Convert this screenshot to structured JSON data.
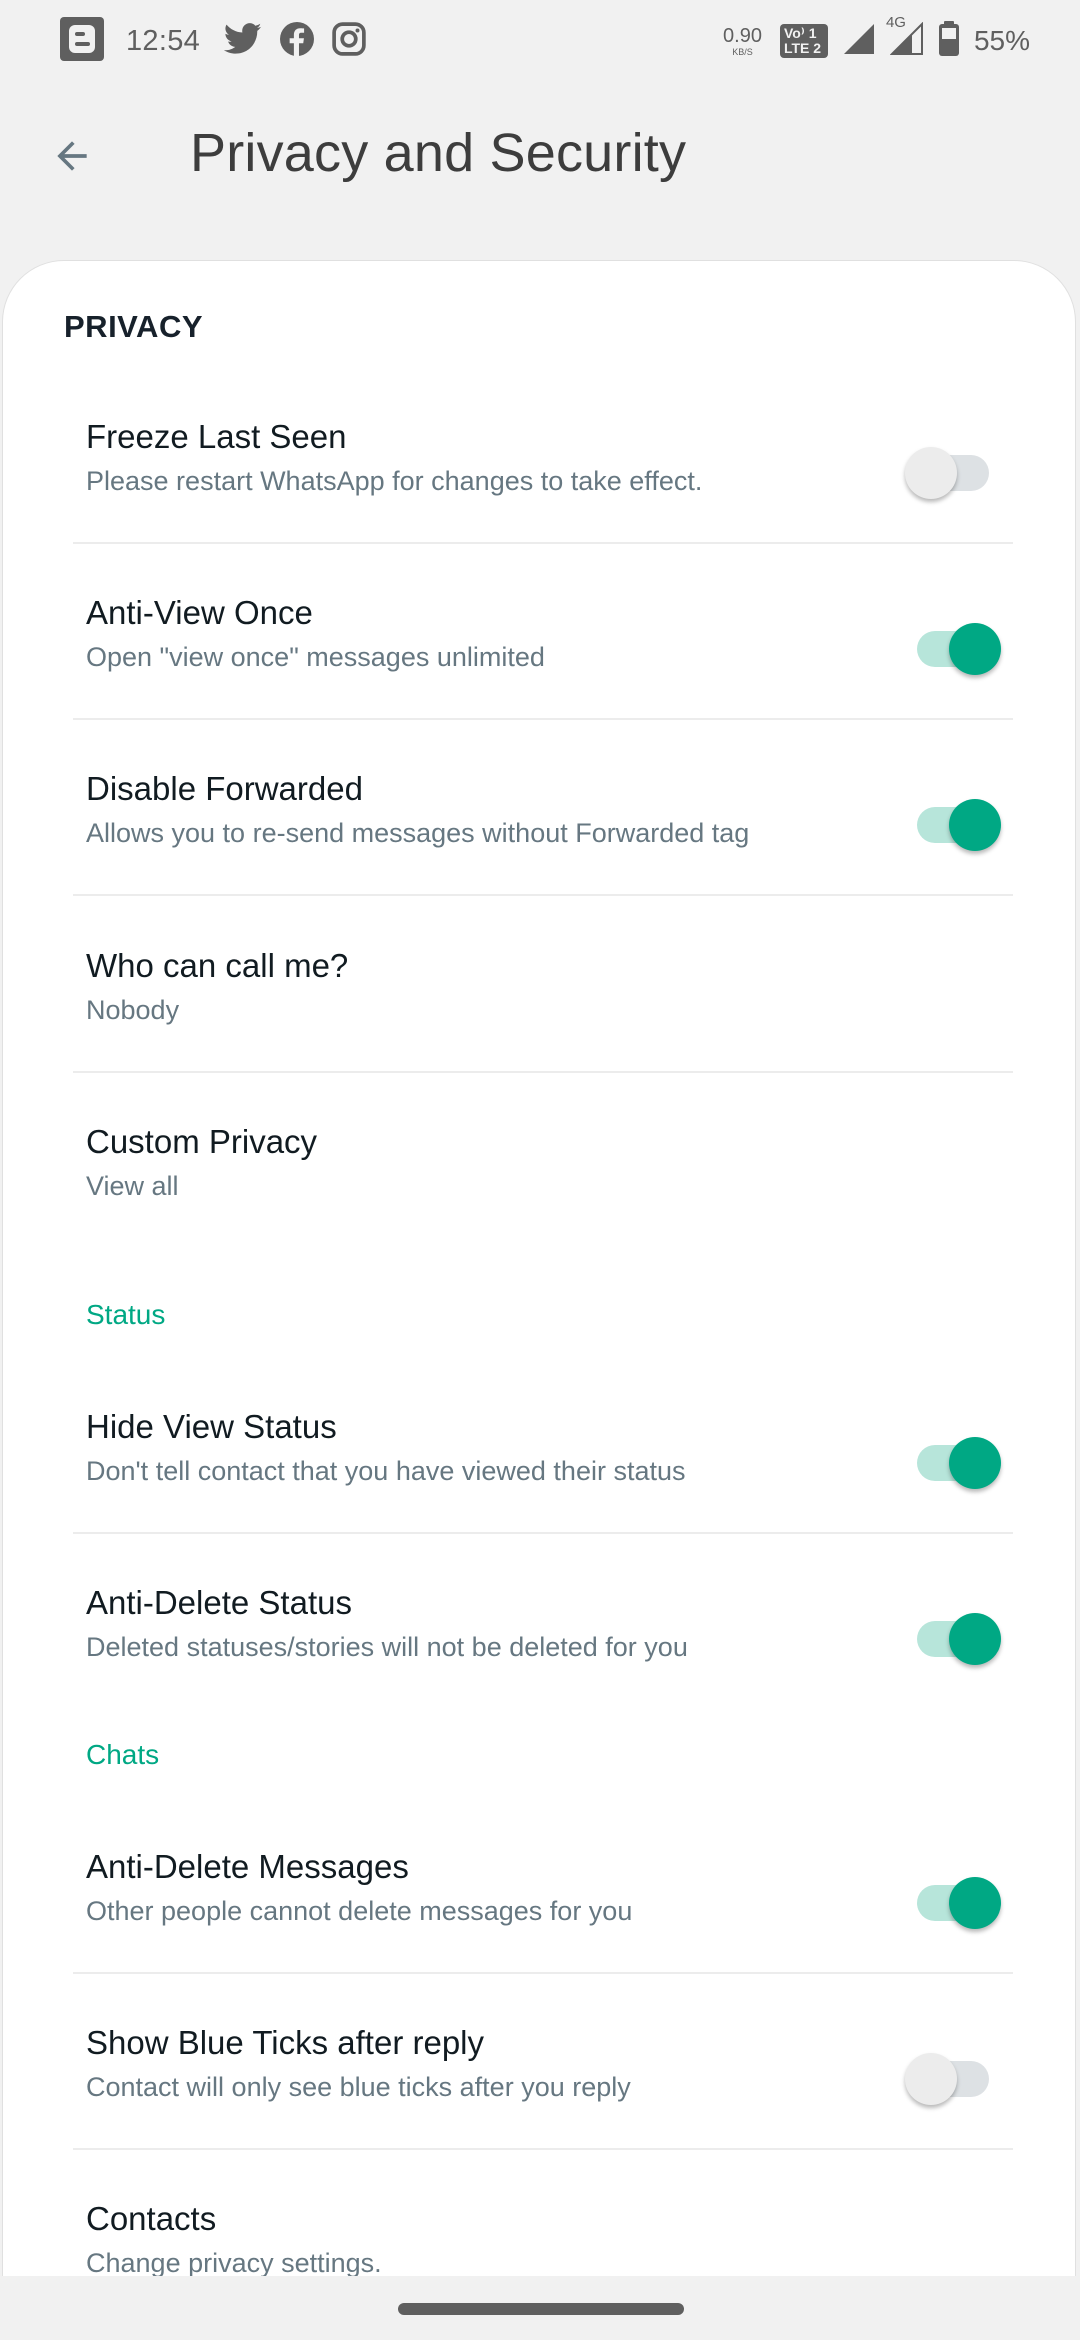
{
  "status_bar": {
    "time": "12:54",
    "notification_icons": [
      "blogger-icon",
      "twitter-icon",
      "facebook-icon",
      "instagram-icon"
    ],
    "net_speed_value": "0.90",
    "net_speed_unit": "KB/S",
    "volte_line1": "Vo⁾ 1",
    "volte_line2": "LTE 2",
    "network_type": "4G",
    "battery_percent": "55%"
  },
  "app_bar": {
    "back_icon": "arrow-back-icon",
    "title": "Privacy and Security"
  },
  "colors": {
    "accent": "#00a884",
    "accent_track": "#b7e5da",
    "title_text": "#111b21",
    "subtitle_text": "#667781",
    "background": "#f1f1f1"
  },
  "sections": {
    "privacy": {
      "header": "PRIVACY",
      "items": [
        {
          "title": "Freeze Last Seen",
          "subtitle": "Please restart WhatsApp for changes to take effect.",
          "has_switch": true,
          "enabled": false
        },
        {
          "title": "Anti-View Once",
          "subtitle": "Open \"view once\" messages unlimited",
          "has_switch": true,
          "enabled": true
        },
        {
          "title": "Disable Forwarded",
          "subtitle": "Allows you to re-send messages without Forwarded tag",
          "has_switch": true,
          "enabled": true
        },
        {
          "title": "Who can call me?",
          "subtitle": "Nobody",
          "has_switch": false
        },
        {
          "title": "Custom Privacy",
          "subtitle": "View all",
          "has_switch": false
        }
      ]
    },
    "status": {
      "header": "Status",
      "items": [
        {
          "title": "Hide View Status",
          "subtitle": "Don't tell contact that you have viewed their status",
          "has_switch": true,
          "enabled": true
        },
        {
          "title": "Anti-Delete Status",
          "subtitle": "Deleted statuses/stories will not be deleted for you",
          "has_switch": true,
          "enabled": true
        }
      ]
    },
    "chats": {
      "header": "Chats",
      "items": [
        {
          "title": "Anti-Delete Messages",
          "subtitle": "Other people cannot delete messages for you",
          "has_switch": true,
          "enabled": true
        },
        {
          "title": "Show Blue Ticks after reply",
          "subtitle": "Contact will only see blue ticks after you reply",
          "has_switch": true,
          "enabled": false
        },
        {
          "title": "Contacts",
          "subtitle": "Change privacy settings.",
          "has_switch": false
        }
      ]
    }
  }
}
